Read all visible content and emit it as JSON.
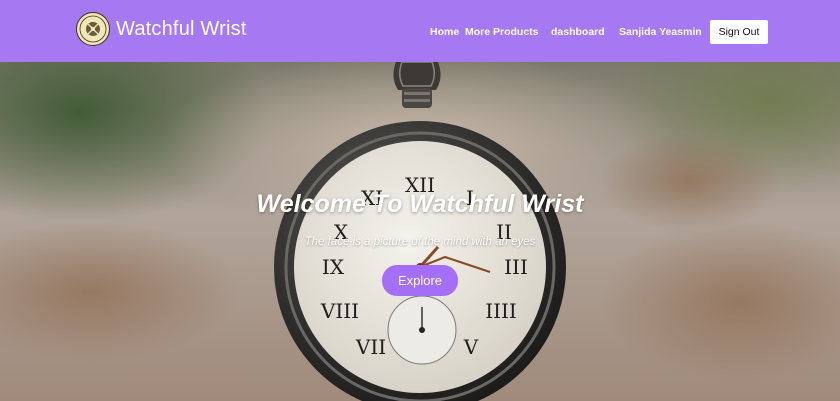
{
  "brand": {
    "name": "Watchful Wrist",
    "logo_icon": "watch-emblem-icon"
  },
  "nav": {
    "home": "Home",
    "more_products": "More Products",
    "dashboard": "dashboard",
    "user_name": "Sanjida Yeasmin",
    "sign_out": "Sign Out"
  },
  "hero": {
    "title": "Welcome To Watchful Wrist",
    "subtitle": "The face is a picture of the mind with an eyes",
    "explore": "Explore"
  },
  "colors": {
    "navbar": "#a678f2",
    "accent_button": "#a56ef7",
    "text_light": "#ffffff"
  }
}
